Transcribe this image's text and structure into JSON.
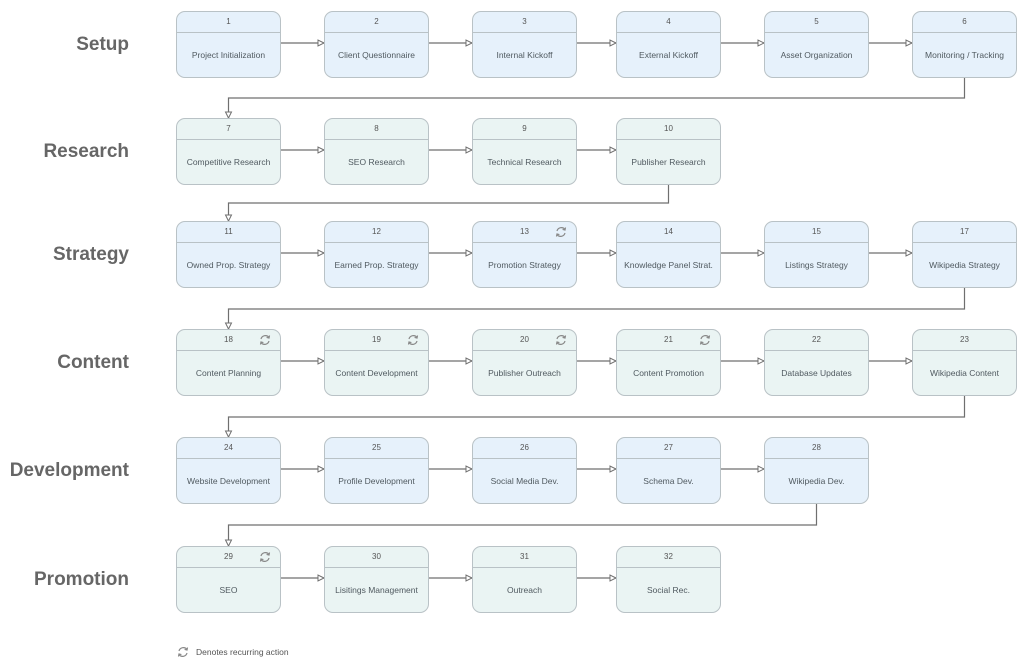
{
  "colors": {
    "blue_box": "#e6f1fb",
    "green_box": "#eaf4f3",
    "border": "#b9c2c6",
    "label": "#666666",
    "wire": "#6f6f6f"
  },
  "phases": [
    {
      "name": "Setup",
      "color": "blue",
      "steps": [
        {
          "num": "1",
          "title": "Project Initialization",
          "recurring": false
        },
        {
          "num": "2",
          "title": "Client Questionnaire",
          "recurring": false
        },
        {
          "num": "3",
          "title": "Internal Kickoff",
          "recurring": false
        },
        {
          "num": "4",
          "title": "External Kickoff",
          "recurring": false
        },
        {
          "num": "5",
          "title": "Asset Organization",
          "recurring": false
        },
        {
          "num": "6",
          "title": "Monitoring / Tracking",
          "recurring": false
        }
      ]
    },
    {
      "name": "Research",
      "color": "green",
      "steps": [
        {
          "num": "7",
          "title": "Competitive Research",
          "recurring": false
        },
        {
          "num": "8",
          "title": "SEO Research",
          "recurring": false
        },
        {
          "num": "9",
          "title": "Technical Research",
          "recurring": false
        },
        {
          "num": "10",
          "title": "Publisher Research",
          "recurring": false
        }
      ]
    },
    {
      "name": "Strategy",
      "color": "blue",
      "steps": [
        {
          "num": "11",
          "title": "Owned Prop. Strategy",
          "recurring": false
        },
        {
          "num": "12",
          "title": "Earned Prop. Strategy",
          "recurring": false
        },
        {
          "num": "13",
          "title": "Promotion Strategy",
          "recurring": true
        },
        {
          "num": "14",
          "title": "Knowledge Panel Strat.",
          "recurring": false
        },
        {
          "num": "15",
          "title": "Listings Strategy",
          "recurring": false
        },
        {
          "num": "17",
          "title": "Wikipedia Strategy",
          "recurring": false
        }
      ]
    },
    {
      "name": "Content",
      "color": "green",
      "steps": [
        {
          "num": "18",
          "title": "Content Planning",
          "recurring": true
        },
        {
          "num": "19",
          "title": "Content Development",
          "recurring": true
        },
        {
          "num": "20",
          "title": "Publisher Outreach",
          "recurring": true
        },
        {
          "num": "21",
          "title": "Content Promotion",
          "recurring": true
        },
        {
          "num": "22",
          "title": "Database Updates",
          "recurring": false
        },
        {
          "num": "23",
          "title": "Wikipedia Content",
          "recurring": false
        }
      ]
    },
    {
      "name": "Development",
      "color": "blue",
      "steps": [
        {
          "num": "24",
          "title": "Website Development",
          "recurring": false
        },
        {
          "num": "25",
          "title": "Profile Development",
          "recurring": false
        },
        {
          "num": "26",
          "title": "Social Media Dev.",
          "recurring": false
        },
        {
          "num": "27",
          "title": "Schema Dev.",
          "recurring": false
        },
        {
          "num": "28",
          "title": "Wikipedia Dev.",
          "recurring": false
        }
      ]
    },
    {
      "name": "Promotion",
      "color": "green",
      "steps": [
        {
          "num": "29",
          "title": "SEO",
          "recurring": true
        },
        {
          "num": "30",
          "title": "Lisitings Management",
          "recurring": false
        },
        {
          "num": "31",
          "title": "Outreach",
          "recurring": false
        },
        {
          "num": "32",
          "title": "Social Rec.",
          "recurring": false
        }
      ]
    }
  ],
  "legend": {
    "icon": "recurring-icon",
    "text": "Denotes recurring action"
  }
}
